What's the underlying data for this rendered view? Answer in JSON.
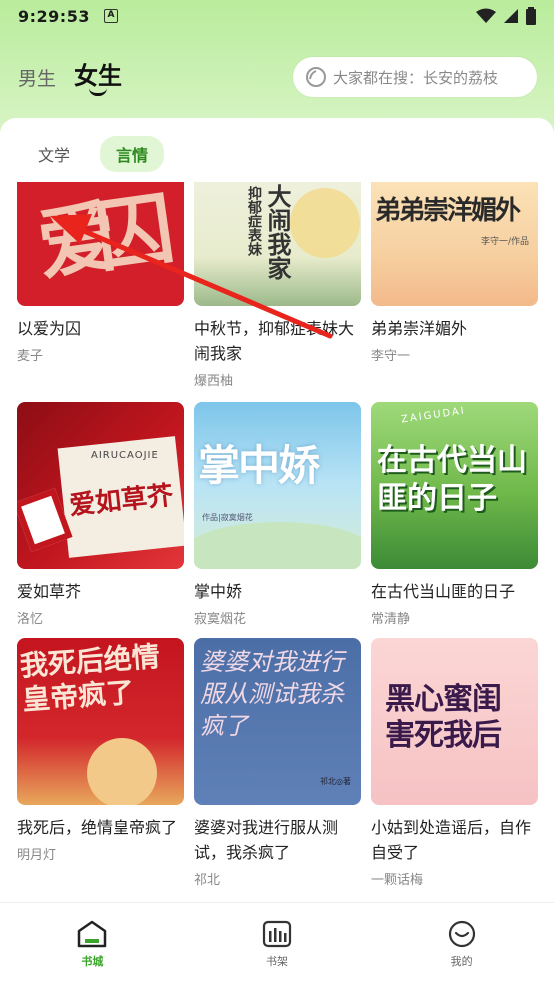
{
  "status_bar": {
    "time": "9:29:53",
    "notification_icon": "A"
  },
  "header": {
    "gender_tabs": [
      {
        "label": "男生"
      },
      {
        "label": "女生"
      }
    ],
    "search": {
      "placeholder": "大家都在搜：长安的荔枝",
      "icon": "search-icon"
    }
  },
  "category_tabs": [
    {
      "label": "文学"
    },
    {
      "label": "言情"
    }
  ],
  "books": [
    {
      "title": "以爱为囚",
      "author": "麦子",
      "cover_text": "爱囚",
      "cover_color": "#d21f2a"
    },
    {
      "title": "中秋节，抑郁症表妹大闹我家",
      "author": "爆西柚",
      "cover_text": "大闹我家",
      "cover_text2": "抑郁症表妹",
      "cover_color": "#e9ecd8"
    },
    {
      "title": "弟弟崇洋媚外",
      "author": "李守一",
      "cover_text": "弟弟崇洋媚外",
      "cover_sub": "李守一/作品",
      "cover_color": "#f7d3a6"
    },
    {
      "title": "爱如草芥",
      "author": "洛忆",
      "cover_text": "爱如草芥",
      "cover_en": "AIRUCAOJIE",
      "cover_color": "#b8121c"
    },
    {
      "title": "掌中娇",
      "author": "寂寞烟花",
      "cover_text": "掌中娇",
      "cover_sub": "作品|寂寞烟花",
      "cover_color": "#9fd6ee"
    },
    {
      "title": "在古代当山匪的日子",
      "author": "常清静",
      "cover_text": "在古代当山匪的日子",
      "cover_en": "ZAIGUDAI",
      "cover_color": "#6fb84a"
    },
    {
      "title": "我死后，绝情皇帝疯了",
      "author": "明月灯",
      "cover_text": "我死后绝情皇帝疯了",
      "cover_color": "#c01822"
    },
    {
      "title": "婆婆对我进行服从测试，我杀疯了",
      "author": "祁北",
      "cover_text": "婆婆对我进行服从测试我杀疯了",
      "cover_sub": "祁北◎著",
      "cover_color": "#5a7ab0"
    },
    {
      "title": "小姑到处造谣后，自作自受了",
      "author": "一颗话梅",
      "cover_text": "黑心蜜闺害死我后",
      "cover_color": "#f5c6c8"
    }
  ],
  "bottom_nav": [
    {
      "label": "书城",
      "icon": "bookstore-icon",
      "active": true
    },
    {
      "label": "书架",
      "icon": "bookshelf-icon",
      "active": false
    },
    {
      "label": "我的",
      "icon": "profile-icon",
      "active": false
    }
  ],
  "colors": {
    "accent": "#3aa52a",
    "active_tab_bg": "#e1f6d5",
    "arrow": "#e8241c"
  }
}
